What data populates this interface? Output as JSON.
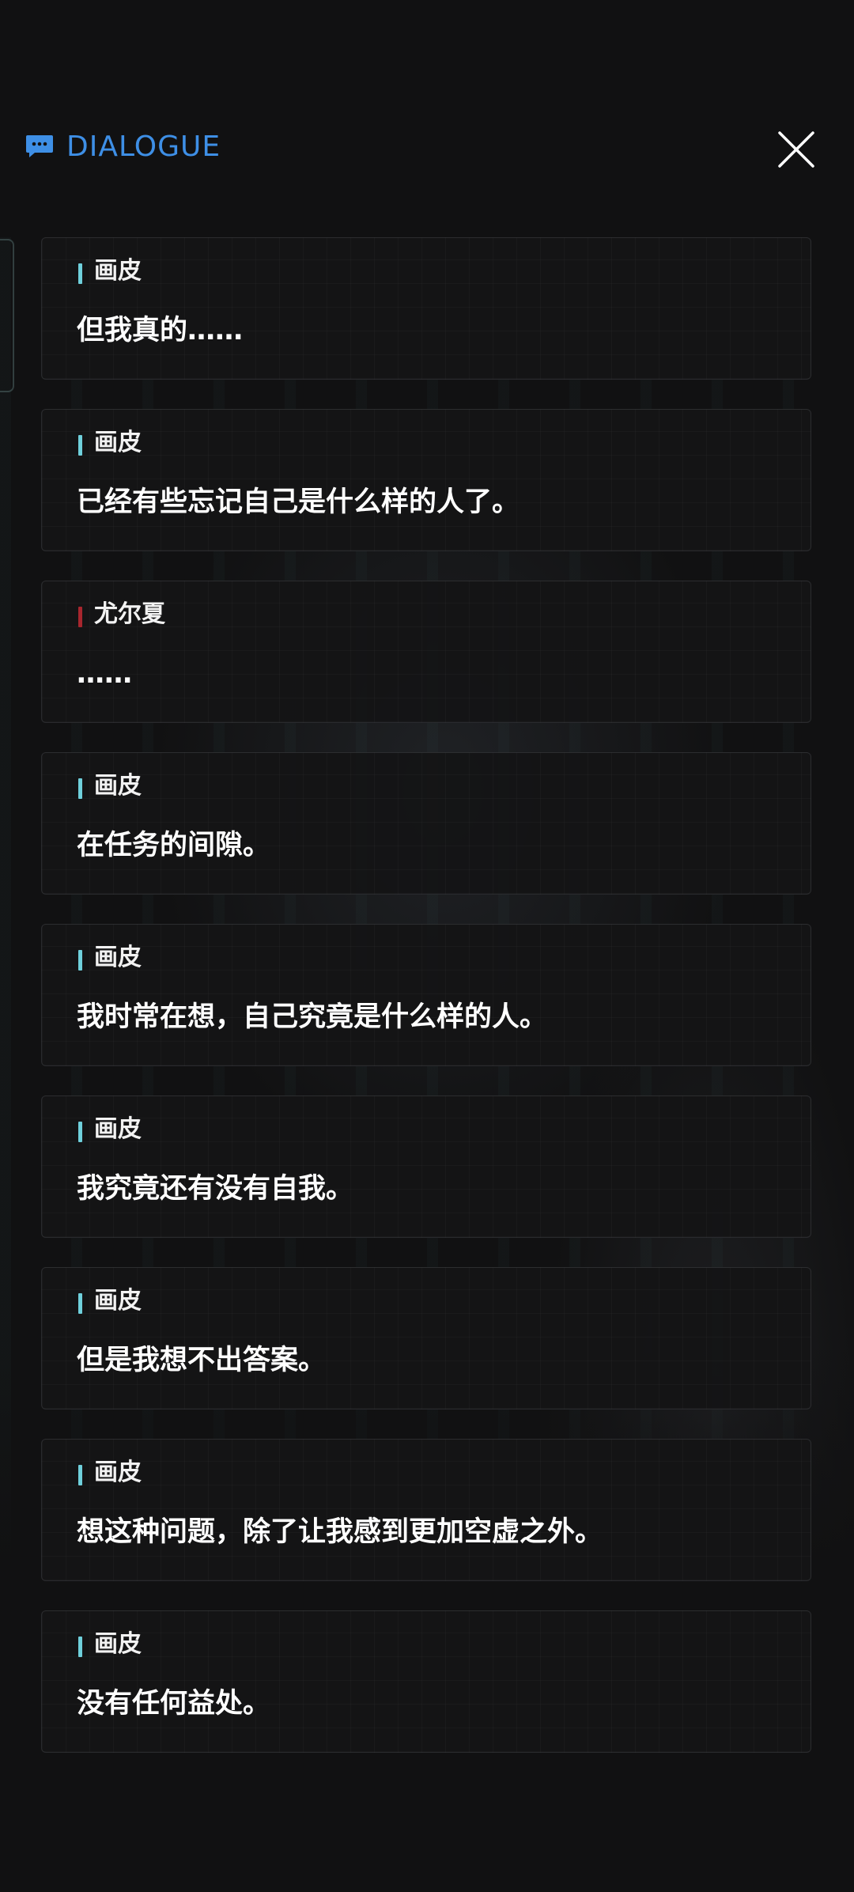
{
  "header": {
    "title": "DIALOGUE",
    "icon": "chat-bubble-icon",
    "accent_color": "#3e8fe6",
    "close_icon": "close-icon"
  },
  "colors": {
    "speaker_bar_cyan": "#6fd0dc",
    "speaker_bar_red": "#a8262e"
  },
  "dialogue": [
    {
      "speaker": "画皮",
      "text": "但我真的……",
      "bar_color": "#6fd0dc"
    },
    {
      "speaker": "画皮",
      "text": "已经有些忘记自己是什么样的人了。",
      "bar_color": "#6fd0dc"
    },
    {
      "speaker": "尤尔夏",
      "text": "……",
      "bar_color": "#a8262e"
    },
    {
      "speaker": "画皮",
      "text": "在任务的间隙。",
      "bar_color": "#6fd0dc"
    },
    {
      "speaker": "画皮",
      "text": "我时常在想，自己究竟是什么样的人。",
      "bar_color": "#6fd0dc"
    },
    {
      "speaker": "画皮",
      "text": "我究竟还有没有自我。",
      "bar_color": "#6fd0dc"
    },
    {
      "speaker": "画皮",
      "text": "但是我想不出答案。",
      "bar_color": "#6fd0dc"
    },
    {
      "speaker": "画皮",
      "text": "想这种问题，除了让我感到更加空虚之外。",
      "bar_color": "#6fd0dc"
    },
    {
      "speaker": "画皮",
      "text": "没有任何益处。",
      "bar_color": "#6fd0dc"
    }
  ]
}
